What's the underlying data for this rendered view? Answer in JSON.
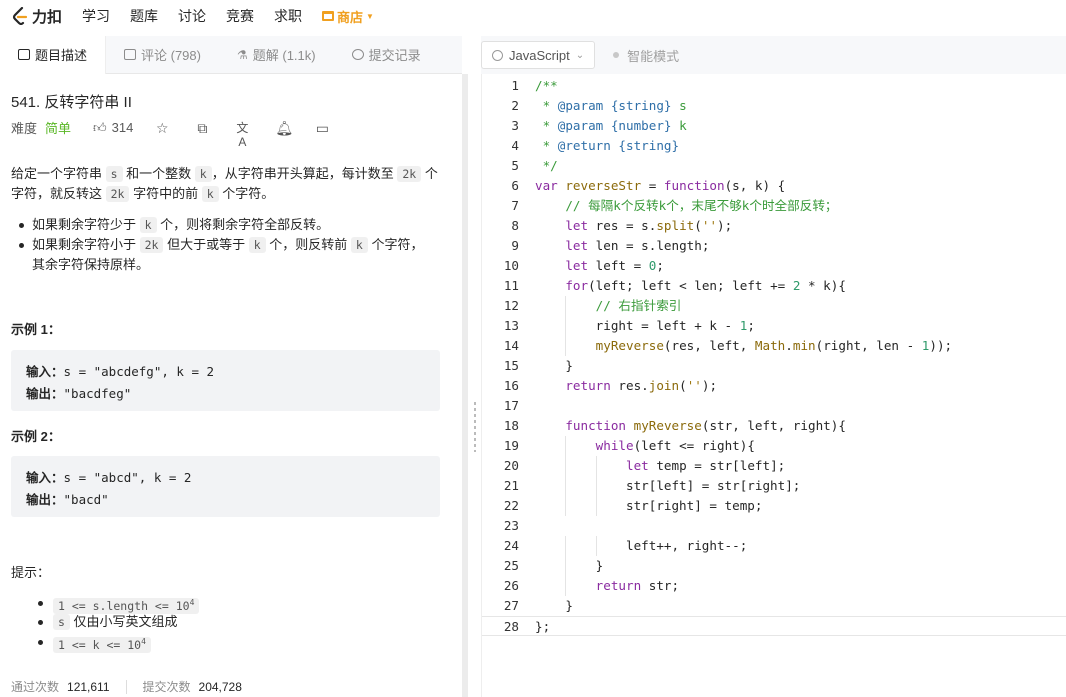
{
  "nav": {
    "logo_text": "力扣",
    "items": [
      "学习",
      "题库",
      "讨论",
      "竞赛",
      "求职"
    ],
    "store": "商店",
    "colors": {
      "store": "#f0a020",
      "easy": "#5ab726"
    }
  },
  "tabs": [
    {
      "label": "题目描述",
      "icon": "description-icon"
    },
    {
      "label": "评论 (798)",
      "icon": "comment-icon"
    },
    {
      "label": "题解 (1.1k)",
      "icon": "flask-icon"
    },
    {
      "label": "提交记录",
      "icon": "clock-icon"
    }
  ],
  "toolbar": {
    "language": "JavaScript",
    "smart_mode": "智能模式"
  },
  "problem": {
    "title": "541. 反转字符串 II",
    "difficulty_label": "难度",
    "difficulty": "简单",
    "likes": "314",
    "icons": [
      "star-icon",
      "share-icon",
      "translate-icon",
      "bell-icon",
      "feedback-icon"
    ],
    "desc1": [
      "给定一个字符串 ",
      "s",
      " 和一个整数 ",
      "k",
      "，从字符串开头算起，每计数至 ",
      "2k",
      " 个"
    ],
    "desc2": [
      "字符，就反转这 ",
      "2k",
      " 字符中的前 ",
      "k",
      " 个字符。"
    ],
    "bullet1": [
      "如果剩余字符少于 ",
      "k",
      " 个，则将剩余字符全部反转。"
    ],
    "bullet2a": [
      "如果剩余字符小于 ",
      "2k",
      " 但大于或等于 ",
      "k",
      " 个，则反转前 ",
      "k",
      " 个字符，"
    ],
    "bullet2b": "其余字符保持原样。",
    "examples": [
      {
        "label": "示例 1：",
        "in_label": "输入：",
        "input": "s = \"abcdefg\", k = 2",
        "out_label": "输出：",
        "output": "\"bacdfeg\""
      },
      {
        "label": "示例 2：",
        "in_label": "输入：",
        "input": "s = \"abcd\", k = 2",
        "out_label": "输出：",
        "output": "\"bacd\""
      }
    ],
    "hint_label": "提示：",
    "hints": [
      {
        "code": "1 <= s.length <= 10",
        "sup": "4",
        "text": ""
      },
      {
        "code": "s",
        "sup": "",
        "text": " 仅由小写英文组成"
      },
      {
        "code": "1 <= k <= 10",
        "sup": "4",
        "text": ""
      }
    ],
    "stats": {
      "passed_label": "通过次数",
      "passed": "121,611",
      "submitted_label": "提交次数",
      "submitted": "204,728"
    }
  },
  "code_lines": [
    "/**",
    " * @param {string} s",
    " * @param {number} k",
    " * @return {string}",
    " */",
    "var reverseStr = function(s, k) {",
    "    // 每隔k个反转k个，末尾不够k个时全部反转；",
    "    let res = s.split('');",
    "    let len = s.length;",
    "    let left = 0;",
    "    for(left; left < len; left += 2 * k){",
    "        // 右指针索引",
    "        right = left + k - 1;",
    "        myReverse(res, left, Math.min(right, len - 1));",
    "    }",
    "    return res.join('');",
    "",
    "    function myReverse(str, left, right){",
    "        while(left <= right){",
    "            let temp = str[left];",
    "            str[left] = str[right];",
    "            str[right] = temp;",
    "",
    "            left++, right--;",
    "        }",
    "        return str;",
    "    }",
    "};"
  ]
}
